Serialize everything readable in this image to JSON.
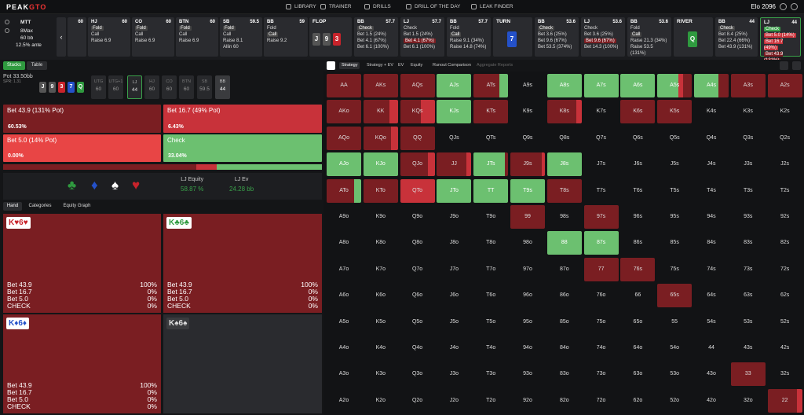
{
  "brand": {
    "logo_a": "PEAK",
    "logo_b": "GTO"
  },
  "nav": [
    {
      "label": "LIBRARY",
      "icon": "library-icon"
    },
    {
      "label": "TRAINER",
      "icon": "trainer-icon"
    },
    {
      "label": "DRILLS",
      "icon": "drills-icon"
    },
    {
      "label": "DRILL OF THE DAY",
      "icon": "drill-of-day-icon"
    },
    {
      "label": "LEAK FINDER",
      "icon": "leak-finder-icon"
    }
  ],
  "user": {
    "elo_label": "Elo",
    "elo": "2096"
  },
  "game": {
    "type": "MTT",
    "table": "8Max",
    "stack": "60 bb",
    "ante": "12.5% ante"
  },
  "positions": [
    {
      "name": "",
      "stack": "60"
    },
    {
      "name": "HJ",
      "stack": "60",
      "options": [
        "Fold",
        "Call",
        "Raise 6.9"
      ]
    },
    {
      "name": "CO",
      "stack": "60",
      "options": [
        "Fold",
        "Call",
        "Raise 6.9"
      ]
    },
    {
      "name": "BTN",
      "stack": "60",
      "options": [
        "Fold",
        "Call",
        "Raise 6.9"
      ]
    },
    {
      "name": "SB",
      "stack": "59.5",
      "options": [
        "Fold",
        "Call",
        "Raise 8.1",
        "Allin 60"
      ]
    },
    {
      "name": "BB",
      "stack": "59",
      "options": [
        "Fold",
        "Call",
        "Raise 9.2"
      ]
    }
  ],
  "flop": {
    "label": "FLOP",
    "cards": [
      "J",
      "9",
      "3"
    ]
  },
  "flop_actions": [
    {
      "name": "BB",
      "stack": "57.7",
      "options": [
        "Check",
        "Bet 1.5 (24%)",
        "Bet 4.1 (67%)",
        "Bet 6.1 (100%)"
      ]
    },
    {
      "name": "LJ",
      "stack": "57.7",
      "options": [
        "Check",
        "Bet 1.5 (24%)",
        "Bet 4.1 (67%)",
        "Bet 6.1 (100%)"
      ]
    },
    {
      "name": "BB",
      "stack": "57.7",
      "options": [
        "Fold",
        "Call",
        "Raise 9.1 (34%)",
        "Raise 14.8 (74%)"
      ]
    }
  ],
  "turn": {
    "label": "TURN",
    "card": "7"
  },
  "turn_actions": [
    {
      "name": "BB",
      "stack": "53.6",
      "options": [
        "Check",
        "Bet 3.6 (25%)",
        "Bet 9.6 (67%)",
        "Bet 53.5 (374%)"
      ]
    },
    {
      "name": "LJ",
      "stack": "53.6",
      "options": [
        "Check",
        "Bet 3.6 (25%)",
        "Bet 9.6 (67%)",
        "Bet 14.3 (100%)",
        "Bet 28.6 (200%)"
      ]
    },
    {
      "name": "BB",
      "stack": "53.6",
      "options": [
        "Fold",
        "Call",
        "Raise 21.3 (34%)",
        "Raise 53.5 (131%)"
      ]
    }
  ],
  "river": {
    "label": "RIVER",
    "card": "Q"
  },
  "river_actions": [
    {
      "name": "BB",
      "stack": "44",
      "options": [
        "Check",
        "Bet 8.4 (25%)",
        "Bet 22.4 (66%)",
        "Bet 43.9 (131%)"
      ]
    },
    {
      "name": "LJ",
      "stack": "44",
      "options": [
        "Check",
        "Bet 5.0 (14%)",
        "Bet 16.7 (49%)",
        "Bet 43.9 (131%)"
      ]
    }
  ],
  "left_tabs": {
    "stacks": "Stacks",
    "table": "Table"
  },
  "pot": {
    "label": "Pot",
    "value": "33.50bb",
    "spr": "SPR: 1.31"
  },
  "board": [
    "J",
    "9",
    "3",
    "7",
    "Q"
  ],
  "seats": [
    {
      "name": "UTG",
      "stack": "60"
    },
    {
      "name": "UTG+1",
      "stack": "60"
    },
    {
      "name": "LJ",
      "stack": "44"
    },
    {
      "name": "HJ",
      "stack": "60"
    },
    {
      "name": "CO",
      "stack": "60"
    },
    {
      "name": "BTN",
      "stack": "60"
    },
    {
      "name": "SB",
      "stack": "59.5"
    },
    {
      "name": "BB",
      "stack": "44"
    }
  ],
  "actions": [
    {
      "label": "Bet 43.9 (131% Pot)",
      "pct": "60.53%"
    },
    {
      "label": "Bet 16.7 (49% Pot)",
      "pct": "6.43%"
    },
    {
      "label": "Bet 5.0 (14% Pot)",
      "pct": "0.00%"
    },
    {
      "label": "Check",
      "pct": "33.04%"
    }
  ],
  "suits": [
    "♣",
    "♦",
    "♠",
    "♥"
  ],
  "equity": {
    "eq_label": "LJ Equity",
    "eq_value": "58.87 %",
    "ev_label": "LJ Ev",
    "ev_value": "24.28 bb"
  },
  "hand_tabs": {
    "hand": "Hand",
    "categories": "Categories",
    "graph": "Equity Graph"
  },
  "combos": [
    {
      "cards": "K♥6♥",
      "stats": [
        {
          "a": "Bet 43.9",
          "v": "100%"
        },
        {
          "a": "Bet 16.7",
          "v": "0%"
        },
        {
          "a": "Bet 5.0",
          "v": "0%"
        },
        {
          "a": "CHECK",
          "v": "0%"
        }
      ]
    },
    {
      "cards": "K♣6♣",
      "stats": [
        {
          "a": "Bet 43.9",
          "v": "100%"
        },
        {
          "a": "Bet 16.7",
          "v": "0%"
        },
        {
          "a": "Bet 5.0",
          "v": "0%"
        },
        {
          "a": "CHECK",
          "v": "0%"
        }
      ]
    },
    {
      "cards": "K♦6♦",
      "stats": [
        {
          "a": "Bet 43.9",
          "v": "100%"
        },
        {
          "a": "Bet 16.7",
          "v": "0%"
        },
        {
          "a": "Bet 5.0",
          "v": "0%"
        },
        {
          "a": "CHECK",
          "v": "0%"
        }
      ]
    },
    {
      "cards": "K♠6♠",
      "stats": []
    }
  ],
  "grid_tabs": [
    "Strategy",
    "Strategy + EV",
    "EV",
    "Equity",
    "Runout Comparison",
    "Aggregate Reports"
  ],
  "colors": {
    "bet_big": "#7a1e22",
    "bet_mid": "#c8323a",
    "bet_small": "#e84545",
    "check": "#6cc070",
    "active_green": "#3aa04a"
  }
}
